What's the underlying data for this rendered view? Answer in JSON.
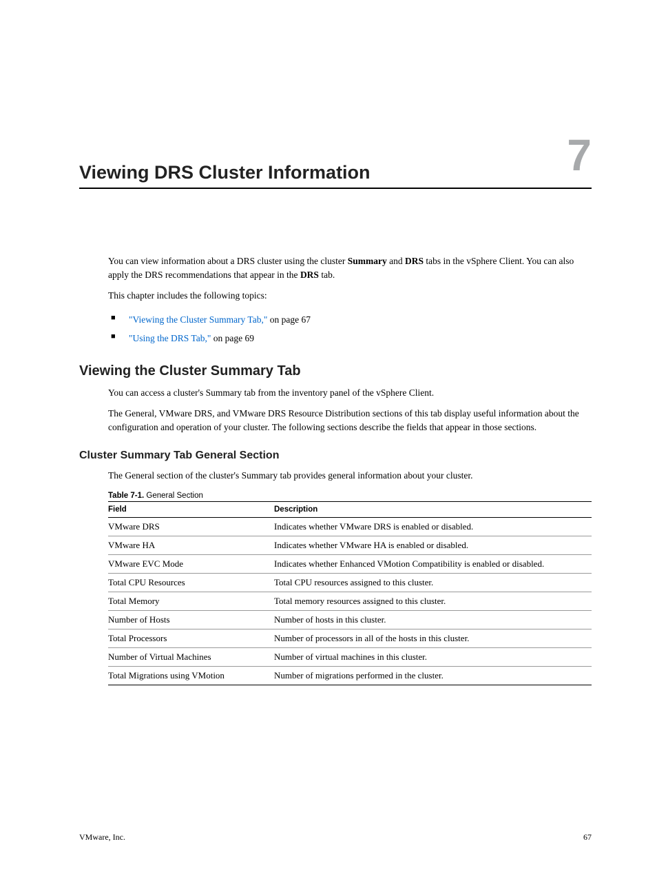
{
  "chapter": {
    "number": "7",
    "title": "Viewing DRS Cluster Information"
  },
  "intro": {
    "p1_a": "You can view information about a DRS cluster using the cluster ",
    "p1_b": "Summary",
    "p1_c": " and ",
    "p1_d": "DRS",
    "p1_e": " tabs in the vSphere Client. You can also apply the DRS recommendations that appear in the ",
    "p1_f": "DRS",
    "p1_g": " tab.",
    "p2": "This chapter includes the following topics:"
  },
  "topics": [
    {
      "link": "\"Viewing the Cluster Summary Tab,\"",
      "suffix": " on page 67"
    },
    {
      "link": "\"Using the DRS Tab,\"",
      "suffix": " on page 69"
    }
  ],
  "section1": {
    "heading": "Viewing the Cluster Summary Tab",
    "p1": "You can access a cluster's Summary tab from the inventory panel of the vSphere Client.",
    "p2": "The General, VMware DRS, and VMware DRS Resource Distribution sections of this tab display useful information about the configuration and operation of your cluster. The following sections describe the fields that appear in those sections."
  },
  "section2": {
    "heading": "Cluster Summary Tab General Section",
    "p1": "The General section of the cluster's Summary tab provides general information about your cluster."
  },
  "table": {
    "caption_label": "Table 7-1.",
    "caption_text": "  General Section",
    "headers": {
      "field": "Field",
      "description": "Description"
    },
    "rows": [
      {
        "field": "VMware DRS",
        "description": "Indicates whether VMware DRS is enabled or disabled."
      },
      {
        "field": "VMware HA",
        "description": "Indicates whether VMware HA is enabled or disabled."
      },
      {
        "field": "VMware EVC Mode",
        "description": "Indicates whether Enhanced VMotion Compatibility is enabled or disabled."
      },
      {
        "field": "Total CPU Resources",
        "description": "Total CPU resources assigned to this cluster."
      },
      {
        "field": "Total Memory",
        "description": "Total memory resources assigned to this cluster."
      },
      {
        "field": "Number of Hosts",
        "description": "Number of hosts in this cluster."
      },
      {
        "field": "Total Processors",
        "description": "Number of processors in all of the hosts in this cluster."
      },
      {
        "field": "Number of Virtual Machines",
        "description": "Number of virtual machines in this cluster."
      },
      {
        "field": "Total Migrations using VMotion",
        "description": "Number of migrations performed in the cluster."
      }
    ]
  },
  "footer": {
    "left": "VMware, Inc.",
    "right": "67"
  }
}
